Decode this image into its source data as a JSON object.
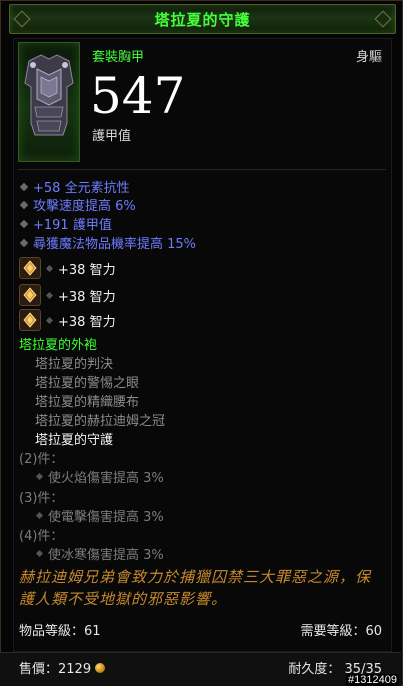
{
  "item": {
    "title": "塔拉夏的守護",
    "type": "套裝胸甲",
    "slot": "身驅",
    "armor_value": "547",
    "armor_label": "護甲值"
  },
  "stats": [
    "+58 全元素抗性",
    "攻擊速度提高 6%",
    "+191 護甲值",
    "尋獲魔法物品機率提高 15%"
  ],
  "sockets": [
    "+38 智力",
    "+38 智力",
    "+38 智力"
  ],
  "set": {
    "name": "塔拉夏的外袍",
    "pieces": [
      "塔拉夏的判決",
      "塔拉夏的警惕之眼",
      "塔拉夏的精織腰布",
      "塔拉夏的赫拉迪姆之冠",
      "塔拉夏的守護"
    ],
    "bonuses": [
      {
        "head": "(2)件：",
        "effect": "使火焰傷害提高 3%"
      },
      {
        "head": "(3)件：",
        "effect": "使電擊傷害提高 3%"
      },
      {
        "head": "(4)件：",
        "effect": "使冰寒傷害提高 3%"
      }
    ]
  },
  "flavor_text": "赫拉迪姆兄弟會致力於捕獵囚禁三大罪惡之源，保護人類不受地獄的邪惡影響。",
  "item_level": "物品等級：61",
  "required_level": "需要等級：60",
  "sell_price": "售價：2129",
  "durability": "耐久度： 35/35",
  "watermark": "#1312409",
  "colors": {
    "set_green": "#44ff3c",
    "magic_blue": "#6e7cff",
    "flavor_gold": "#c8892c",
    "inactive_gray": "#8c8c8c"
  }
}
